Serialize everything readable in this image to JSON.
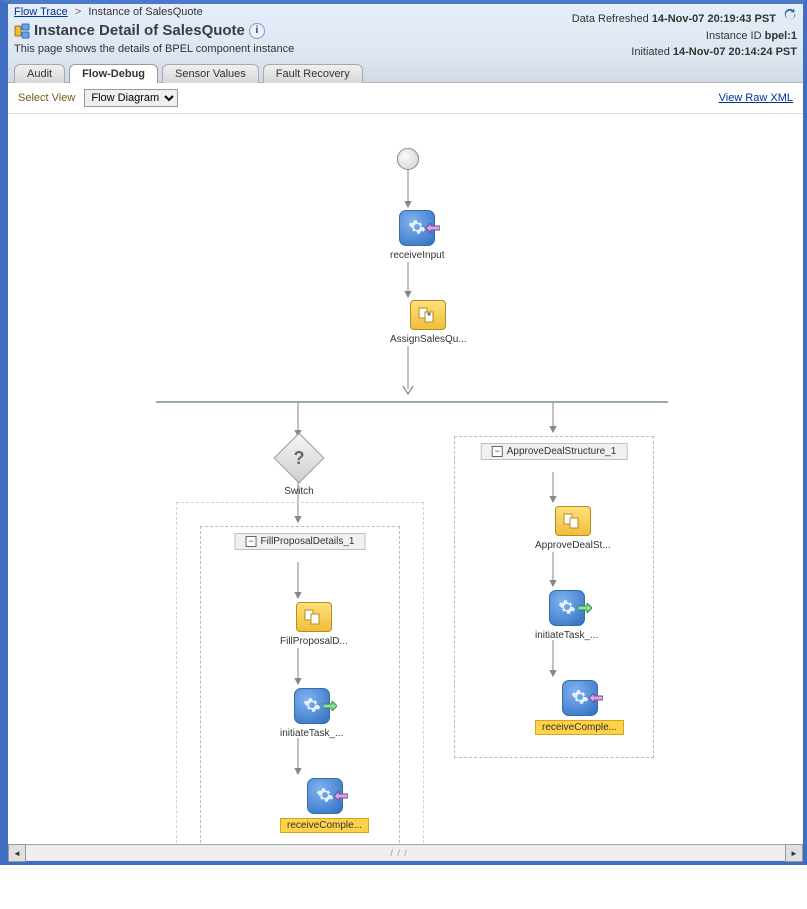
{
  "breadcrumb": {
    "flow_trace": "Flow Trace",
    "sep": ">",
    "instance_current": "Instance of SalesQuote"
  },
  "header": {
    "title": "Instance Detail of SalesQuote",
    "subtitle": "This page shows the details of BPEL component instance",
    "data_refreshed_label": "Data Refreshed",
    "data_refreshed_value": "14-Nov-07 20:19:43 PST",
    "instance_id_label": "Instance ID",
    "instance_id_value": "bpel:1",
    "initiated_label": "Initiated",
    "initiated_value": "14-Nov-07 20:14:24 PST"
  },
  "tabs": {
    "audit": "Audit",
    "flow_debug": "Flow-Debug",
    "sensor_values": "Sensor Values",
    "fault_recovery": "Fault Recovery"
  },
  "toolbar": {
    "select_view_label": "Select View",
    "view_option": "Flow Diagram",
    "raw_xml_link": "View Raw XML"
  },
  "flow": {
    "receive_input": "receiveInput",
    "assign_salesq": "AssignSalesQu...",
    "switch": "Switch",
    "scope_left_title": "FillProposalDetails_1",
    "scope_right_title": "ApproveDealStructure_1",
    "fill_proposal": "FillProposalD...",
    "approve_deal": "ApproveDealSt...",
    "initiate_task_left": "initiateTask_...",
    "initiate_task_right": "initiateTask_...",
    "receive_completed_left": "receiveComple...",
    "receive_completed_right": "receiveComple..."
  }
}
